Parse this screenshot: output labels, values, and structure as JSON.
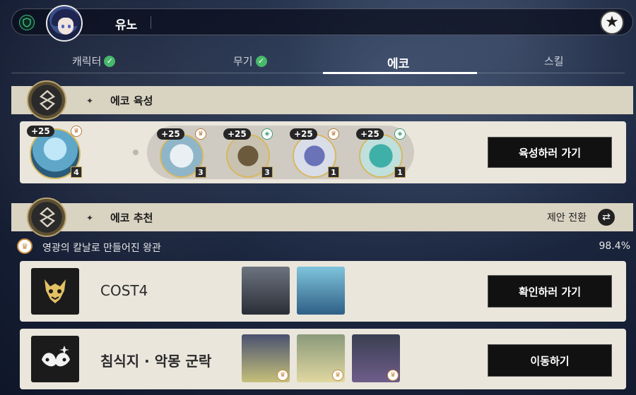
{
  "header": {
    "character_name": "유노",
    "shield_icon": "shield-icon",
    "star_icon": "star-icon"
  },
  "tabs": [
    {
      "label": "캐릭터",
      "checked": true
    },
    {
      "label": "무기",
      "checked": true
    },
    {
      "label": "에코",
      "checked": false,
      "active": true
    },
    {
      "label": "스킬",
      "checked": false
    }
  ],
  "echo_upgrade": {
    "section_title": "에코 육성",
    "main_echo": {
      "level": "+25",
      "cost": "4",
      "set": "crown-emblem"
    },
    "slots": [
      {
        "level": "+25",
        "cost": "3",
        "set": "crown-emblem"
      },
      {
        "level": "+25",
        "cost": "3",
        "set": "green-emblem"
      },
      {
        "level": "+25",
        "cost": "1",
        "set": "crown-emblem"
      },
      {
        "level": "+25",
        "cost": "1",
        "set": "green-emblem"
      }
    ],
    "button_label": "육성하러 가기"
  },
  "echo_recommend": {
    "section_title": "에코 추천",
    "switch_label": "제안 전환",
    "set_name": "영광의 칼날로 만들어진 왕관",
    "set_rate": "98.4%",
    "rows": [
      {
        "title": "COST4",
        "button_label": "확인하러 가기"
      },
      {
        "title": "침식지 · 악몽 군락",
        "button_label": "이동하기"
      }
    ]
  },
  "colors": {
    "accent_gold": "#d7b860",
    "check_green": "#48b86b",
    "panel_bg": "#eae6dc",
    "header_bg": "#d9d3c2"
  }
}
